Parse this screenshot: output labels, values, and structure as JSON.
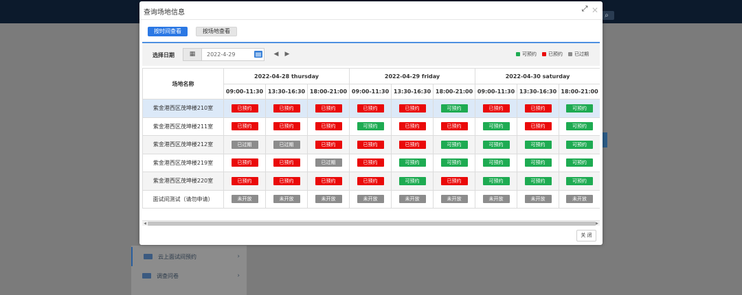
{
  "background": {
    "menu_items": [
      {
        "label": "云上面试间预约",
        "icon": "meeting-room-icon"
      },
      {
        "label": "调查问卷",
        "icon": "survey-icon"
      }
    ]
  },
  "modal": {
    "title": "查询场地信息",
    "tabs": {
      "by_time": "按时间查看",
      "by_venue": "按场地查看"
    },
    "filter": {
      "date_label": "选择日期",
      "date_value": "2022-4-29"
    },
    "legend": [
      {
        "label": "可预约",
        "color": "#1eab52"
      },
      {
        "label": "已预约",
        "color": "#ea0a0a"
      },
      {
        "label": "已过期",
        "color": "#8c8c8c"
      }
    ],
    "table": {
      "room_header": "场地名称",
      "dates": [
        "2022-04-28  thursday",
        "2022-04-29  friday",
        "2022-04-30  saturday"
      ],
      "slots": [
        "09:00-11:30",
        "13:30-16:30",
        "18:00-21:00"
      ],
      "status_labels": {
        "booked": "已预约",
        "available": "可预约",
        "expired": "已过期",
        "closed": "未开放"
      },
      "rows": [
        {
          "room": "紫金港西区茂坤楼210室",
          "cells": [
            "booked",
            "booked",
            "booked",
            "booked",
            "booked",
            "available",
            "booked",
            "booked",
            "available"
          ]
        },
        {
          "room": "紫金港西区茂坤楼211室",
          "cells": [
            "booked",
            "booked",
            "booked",
            "available",
            "booked",
            "booked",
            "available",
            "booked",
            "available"
          ]
        },
        {
          "room": "紫金港西区茂坤楼212室",
          "cells": [
            "expired",
            "expired",
            "booked",
            "booked",
            "booked",
            "available",
            "available",
            "available",
            "available"
          ]
        },
        {
          "room": "紫金港西区茂坤楼219室",
          "cells": [
            "booked",
            "booked",
            "expired",
            "booked",
            "available",
            "available",
            "available",
            "available",
            "available"
          ]
        },
        {
          "room": "紫金港西区茂坤楼220室",
          "cells": [
            "booked",
            "booked",
            "booked",
            "booked",
            "available",
            "booked",
            "available",
            "available",
            "available"
          ]
        },
        {
          "room": "面试间测试（请勿申请）",
          "cells": [
            "closed",
            "closed",
            "closed",
            "closed",
            "closed",
            "closed",
            "closed",
            "closed",
            "closed"
          ]
        }
      ]
    },
    "close_label": "关 闭"
  }
}
